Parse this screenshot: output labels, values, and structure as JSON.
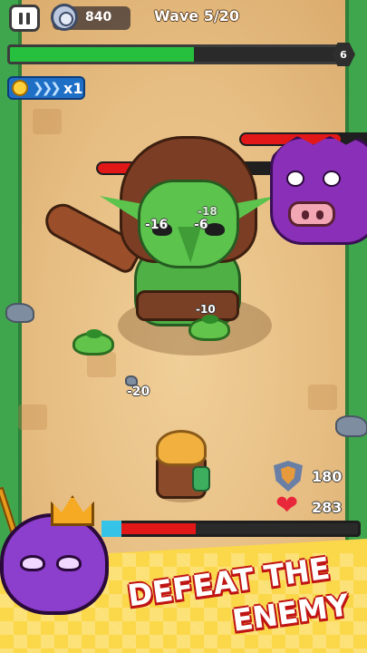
{
  "hud": {
    "coins": "840",
    "wave_label": "Wave 5/20",
    "wave_progress": 0.56,
    "wave_badge": "6",
    "speed_label": "x1",
    "speed_chevrons": "❯❯❯"
  },
  "enemies": {
    "goblin_hp": 0.72,
    "boss_hp": 0.75,
    "bottom_hp": 0.36
  },
  "damage_numbers": [
    "-16",
    "-6",
    "-18",
    "-10",
    "-20"
  ],
  "hero_stats": {
    "shield_value": "180",
    "health_value": "283",
    "heart_glyph": "❤"
  },
  "banner": {
    "line1": "DEFEAT THE",
    "line2": "ENEMY"
  },
  "colors": {
    "wave_fill": "#27c03e",
    "hp_fill": "#e21818",
    "banner_bg": "#fbd74a",
    "headline_outline": "#c01414"
  }
}
